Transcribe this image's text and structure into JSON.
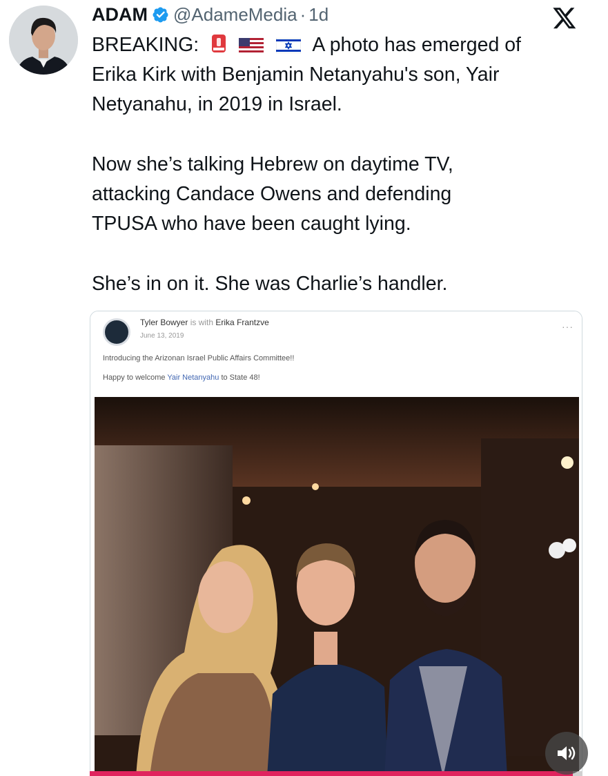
{
  "post": {
    "display_name": "ADAM",
    "handle": "@AdameMedia",
    "separator": "·",
    "time": "1d",
    "verified": true,
    "platform_icon": "x-logo-icon",
    "body": {
      "line1": "BREAKING:",
      "line1_rest": "A photo has emerged of",
      "line2": "Erika Kirk with Benjamin Netanyahu's son, Yair",
      "line3": "Netyanahu, in 2019 in Israel.",
      "line4": "Now she’s talking Hebrew on daytime TV,",
      "line5": "attacking Candace Owens and defending",
      "line6": "TPUSA who have been caught lying.",
      "line7": "She’s in on it. She was Charlie’s handler."
    },
    "emojis": [
      "rotating-light-icon",
      "us-flag-icon",
      "israel-flag-icon"
    ]
  },
  "embedded_post": {
    "author": "Tyler Bowyer",
    "with_text": "is with",
    "tagged": "Erika Frantzve",
    "date": "June 13, 2019",
    "caption_line1": "Introducing the Arizonan Israel Public Affairs Committee!!",
    "caption_line2_prefix": "Happy to welcome",
    "caption_link": "Yair Netanyahu",
    "caption_line2_suffix": "to State 48!",
    "more": "···"
  },
  "video": {
    "progress": 0.98,
    "sound_icon": "speaker-icon"
  },
  "colors": {
    "verified": "#1d9bf0",
    "progress": "#e0245e",
    "link": "#4267b2",
    "muted_text": "#536471"
  }
}
